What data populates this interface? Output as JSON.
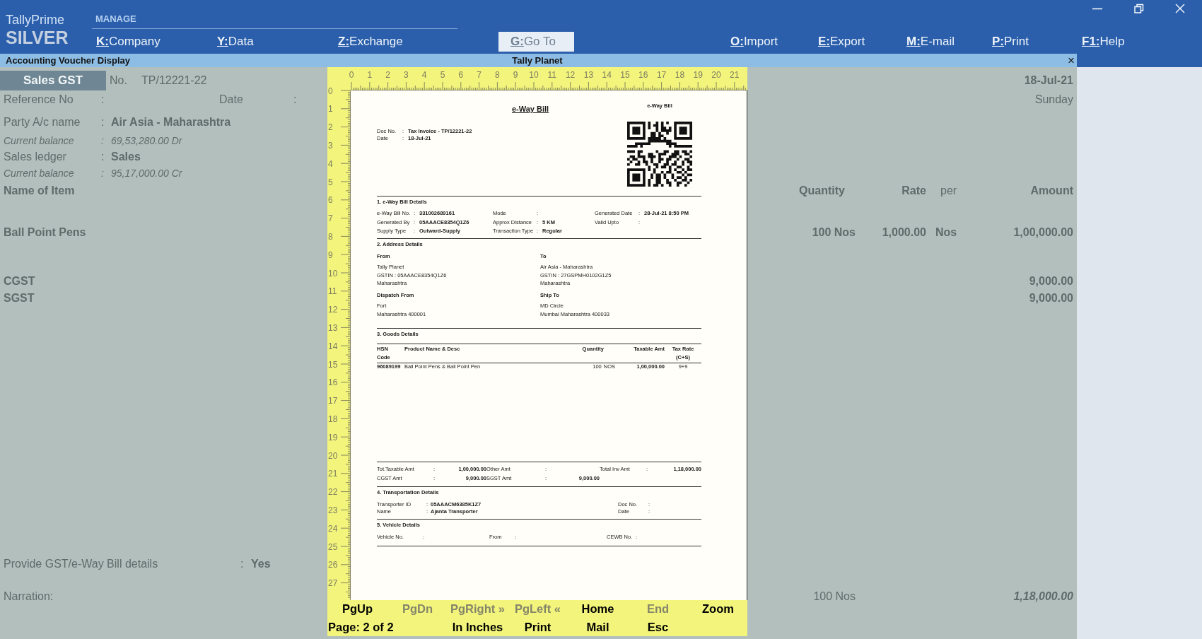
{
  "menu_bar": {
    "product": "TallyPrime",
    "edition": "SILVER",
    "section": "MANAGE",
    "items": [
      {
        "key": "K:",
        "label": "Company",
        "disabled": false
      },
      {
        "key": "Y:",
        "label": "Data",
        "disabled": false
      },
      {
        "key": "Z:",
        "label": "Exchange",
        "disabled": false
      },
      {
        "key": "G:",
        "label": "Go To",
        "disabled": true
      },
      {
        "key": "O:",
        "label": "Import",
        "disabled": false
      },
      {
        "key": "E:",
        "label": "Export",
        "disabled": false
      },
      {
        "key": "M:",
        "label": "E-mail",
        "disabled": false
      },
      {
        "key": "P:",
        "label": "Print",
        "disabled": false
      },
      {
        "key": "F1:",
        "label": "Help",
        "disabled": false
      }
    ]
  },
  "title_bar": {
    "title": "Accounting Voucher Display",
    "dialog_title": "Tally Planet",
    "close": "×"
  },
  "voucher": {
    "type": "Sales GST",
    "number_label": "No.",
    "number": "TP/12221-22",
    "date": "18-Jul-21",
    "day": "Sunday",
    "reference": {
      "label": "Reference No",
      "colon": ":",
      "date_label": "Date",
      "date_colon": ":"
    },
    "ledgers": [
      {
        "kind": "ledger",
        "label": "Party A/c name",
        "colon": ":",
        "value": "Air Asia - Maharashtra"
      },
      {
        "kind": "balance",
        "label": "Current balance",
        "colon": ":",
        "value": "69,53,280.00 Dr"
      },
      {
        "kind": "ledger",
        "label": "Sales ledger",
        "colon": ":",
        "value": "Sales"
      },
      {
        "kind": "balance",
        "label": "Current balance",
        "colon": ":",
        "value": "95,17,000.00 Cr"
      }
    ],
    "columns": [
      "Name of Item",
      "Quantity",
      "Rate",
      "per",
      "Amount"
    ],
    "items": [
      {
        "name": "Ball Point Pens",
        "quantity": "100 Nos",
        "rate": "1,000.00",
        "per": "Nos",
        "amount": "1,00,000.00"
      }
    ],
    "taxes": [
      {
        "name": "CGST",
        "amount": "9,000.00"
      },
      {
        "name": "SGST",
        "amount": "9,000.00"
      }
    ],
    "gst_prompt": {
      "label": "Provide GST/e-Way Bill details",
      "colon": ":",
      "value": "Yes"
    },
    "narration": {
      "label": "Narration:",
      "total_quantity": "100 Nos",
      "total_amount": "1,18,000.00"
    }
  },
  "preview": {
    "ruler": {
      "horizontal": [
        "0",
        "1",
        "2",
        "3",
        "4",
        "5",
        "6",
        "7",
        "8",
        "9",
        "10",
        "11",
        "12",
        "13",
        "14",
        "15",
        "16",
        "17",
        "18",
        "19",
        "20",
        "21"
      ],
      "vertical": [
        "0",
        "1",
        "2",
        "3",
        "4",
        "5",
        "6",
        "7",
        "8",
        "9",
        "10",
        "11",
        "12",
        "13",
        "14",
        "15",
        "16",
        "17",
        "18",
        "19",
        "20",
        "21",
        "22",
        "23",
        "24",
        "25",
        "26",
        "27"
      ]
    },
    "document": {
      "title": "e-Way Bill",
      "qr_caption": "e-Way Bill",
      "header_fields": [
        {
          "label": "Doc No.",
          "colon": ":",
          "value": "Tax Invoice - TP/12221-22"
        },
        {
          "label": "Date",
          "colon": ":",
          "value": "18-Jul-21"
        }
      ],
      "sections": [
        {
          "kind": "fields",
          "heading": "1. e-Way Bill Details",
          "rows": [
            [
              {
                "label": "e-Way Bill No.",
                "colon": ":",
                "value": "331002689161"
              },
              {
                "label": "Mode",
                "colon": ":"
              },
              {
                "label": "Generated Date",
                "colon": ":",
                "value": "28-Jul-21 8:50 PM"
              }
            ],
            [
              {
                "label": "Generated By",
                "colon": ":",
                "value": "05AAACE8354Q1Z6"
              },
              {
                "label": "Approx Distance",
                "colon": ":",
                "value": "5 KM"
              },
              {
                "label": "Valid Upto",
                "colon": ":"
              }
            ],
            [
              {
                "label": "Supply Type",
                "colon": ":",
                "value": "Outward-Supply"
              },
              {
                "label": "Transaction Type",
                "colon": ":",
                "value": "Regular"
              }
            ]
          ]
        },
        {
          "kind": "address",
          "heading": "2. Address Details",
          "blocks": [
            {
              "heading": "From",
              "lines": [
                "Tally Planet",
                "GSTIN : 05AAACE8354Q1Z6",
                "Maharashtra"
              ]
            },
            {
              "heading": "To",
              "lines": [
                "Air Asia - Maharashtra",
                "GSTIN : 27GSPMH0102G1Z5",
                "Maharashtra"
              ]
            },
            {
              "heading": "Dispatch From",
              "lines": [
                "Fort",
                "Maharashtra 400001"
              ]
            },
            {
              "heading": "Ship To",
              "lines": [
                "MD Circle",
                "Mumbai Maharashtra 400033"
              ]
            }
          ]
        },
        {
          "kind": "goods",
          "heading": "3. Goods Details",
          "columns": [
            "HSN Code",
            "Product Name & Desc",
            "Quantity",
            "Taxable Amt",
            "Tax Rate (C+S)"
          ],
          "rows": [
            {
              "hsn": "96089199",
              "product": "Ball Point Pens & Ball Point Pen",
              "quantity": "100",
              "unit": "NOS",
              "taxable": "1,00,000.00",
              "rate": "9+9"
            }
          ]
        },
        {
          "kind": "fields",
          "rows": [
            [
              {
                "label": "Tot.Taxable Amt",
                "colon": ":",
                "value": "1,00,000.00"
              },
              {
                "label": "Other Amt",
                "colon": ":"
              },
              {
                "label": "Total Inv Amt",
                "colon": ":",
                "value": "1,18,000.00"
              }
            ],
            [
              {
                "label": "CGST Amt",
                "colon": ":",
                "value": "9,000.00"
              },
              {
                "label": "SGST Amt",
                "colon": ":",
                "value": "9,000.00"
              }
            ]
          ]
        },
        {
          "kind": "fields",
          "heading": "4. Transportation Details",
          "rows": [
            [
              {
                "label": "Transporter ID",
                "colon": ":",
                "value": "05AAACM6385K1Z7"
              },
              {
                "label": "Doc No.",
                "colon": ":"
              }
            ],
            [
              {
                "label": "Name",
                "colon": ":",
                "value": "Ajanta Transporter"
              },
              {
                "label": "Date",
                "colon": ":"
              }
            ]
          ]
        },
        {
          "kind": "fields",
          "heading": "5. Vehicle Details",
          "rows": [
            [
              {
                "label": "Vehicle No.",
                "colon": ":"
              },
              {
                "label": "From",
                "colon": ":"
              },
              {
                "label": "CEWB No.",
                "colon": ":"
              }
            ]
          ]
        }
      ]
    },
    "footer": {
      "keys": [
        {
          "label": "PgUp",
          "disabled": false
        },
        {
          "label": "PgDn",
          "disabled": true
        },
        {
          "label": "PgRight »",
          "disabled": true
        },
        {
          "label": "PgLeft «",
          "disabled": true
        },
        {
          "label": "Home",
          "disabled": false
        },
        {
          "label": "End",
          "disabled": true
        },
        {
          "label": "Zoom",
          "disabled": false
        }
      ],
      "page": "Page: 2 of 2",
      "commands": [
        {
          "label": "In Inches",
          "disabled": false
        },
        {
          "label": "Print",
          "disabled": false
        },
        {
          "label": "Mail",
          "disabled": false
        },
        {
          "label": "Esc",
          "disabled": false
        }
      ]
    }
  }
}
